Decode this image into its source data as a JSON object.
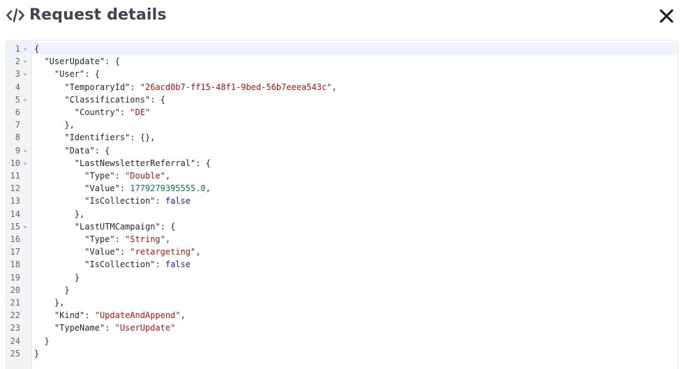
{
  "header": {
    "title": "Request details"
  },
  "icons": {
    "title": "code-icon",
    "close": "close-icon"
  },
  "colors": {
    "string": "#a31515",
    "number": "#0b6e4f",
    "boolean": "#1a1aa6",
    "text": "#1f2328"
  },
  "editor": {
    "active_line": 1,
    "lines": [
      {
        "n": "1",
        "fold": true,
        "indent": 0,
        "tokens": [
          [
            "p",
            "{"
          ]
        ]
      },
      {
        "n": "2",
        "fold": true,
        "indent": 1,
        "tokens": [
          [
            "k",
            "\"UserUpdate\""
          ],
          [
            "p",
            ": {"
          ]
        ]
      },
      {
        "n": "3",
        "fold": true,
        "indent": 2,
        "tokens": [
          [
            "k",
            "\"User\""
          ],
          [
            "p",
            ": {"
          ]
        ]
      },
      {
        "n": "4",
        "fold": false,
        "indent": 3,
        "tokens": [
          [
            "k",
            "\"TemporaryId\""
          ],
          [
            "p",
            ": "
          ],
          [
            "s",
            "\"26acd0b7-ff15-48f1-9bed-56b7eeea543c\""
          ],
          [
            "p",
            ","
          ]
        ]
      },
      {
        "n": "5",
        "fold": true,
        "indent": 3,
        "tokens": [
          [
            "k",
            "\"Classifications\""
          ],
          [
            "p",
            ": {"
          ]
        ]
      },
      {
        "n": "6",
        "fold": false,
        "indent": 4,
        "tokens": [
          [
            "k",
            "\"Country\""
          ],
          [
            "p",
            ": "
          ],
          [
            "s",
            "\"DE\""
          ]
        ]
      },
      {
        "n": "7",
        "fold": false,
        "indent": 3,
        "tokens": [
          [
            "p",
            "},"
          ]
        ]
      },
      {
        "n": "8",
        "fold": false,
        "indent": 3,
        "tokens": [
          [
            "k",
            "\"Identifiers\""
          ],
          [
            "p",
            ": {},"
          ]
        ]
      },
      {
        "n": "9",
        "fold": true,
        "indent": 3,
        "tokens": [
          [
            "k",
            "\"Data\""
          ],
          [
            "p",
            ": {"
          ]
        ]
      },
      {
        "n": "10",
        "fold": true,
        "indent": 4,
        "tokens": [
          [
            "k",
            "\"LastNewsletterReferral\""
          ],
          [
            "p",
            ": {"
          ]
        ]
      },
      {
        "n": "11",
        "fold": false,
        "indent": 5,
        "tokens": [
          [
            "k",
            "\"Type\""
          ],
          [
            "p",
            ": "
          ],
          [
            "s",
            "\"Double\""
          ],
          [
            "p",
            ","
          ]
        ]
      },
      {
        "n": "12",
        "fold": false,
        "indent": 5,
        "tokens": [
          [
            "k",
            "\"Value\""
          ],
          [
            "p",
            ": "
          ],
          [
            "n",
            "1779279395555.0"
          ],
          [
            "p",
            ","
          ]
        ]
      },
      {
        "n": "13",
        "fold": false,
        "indent": 5,
        "tokens": [
          [
            "k",
            "\"IsCollection\""
          ],
          [
            "p",
            ": "
          ],
          [
            "b",
            "false"
          ]
        ]
      },
      {
        "n": "14",
        "fold": false,
        "indent": 4,
        "tokens": [
          [
            "p",
            "},"
          ]
        ]
      },
      {
        "n": "15",
        "fold": true,
        "indent": 4,
        "tokens": [
          [
            "k",
            "\"LastUTMCampaign\""
          ],
          [
            "p",
            ": {"
          ]
        ]
      },
      {
        "n": "16",
        "fold": false,
        "indent": 5,
        "tokens": [
          [
            "k",
            "\"Type\""
          ],
          [
            "p",
            ": "
          ],
          [
            "s",
            "\"String\""
          ],
          [
            "p",
            ","
          ]
        ]
      },
      {
        "n": "17",
        "fold": false,
        "indent": 5,
        "tokens": [
          [
            "k",
            "\"Value\""
          ],
          [
            "p",
            ": "
          ],
          [
            "s",
            "\"retargeting\""
          ],
          [
            "p",
            ","
          ]
        ]
      },
      {
        "n": "18",
        "fold": false,
        "indent": 5,
        "tokens": [
          [
            "k",
            "\"IsCollection\""
          ],
          [
            "p",
            ": "
          ],
          [
            "b",
            "false"
          ]
        ]
      },
      {
        "n": "19",
        "fold": false,
        "indent": 4,
        "tokens": [
          [
            "p",
            "}"
          ]
        ]
      },
      {
        "n": "20",
        "fold": false,
        "indent": 3,
        "tokens": [
          [
            "p",
            "}"
          ]
        ]
      },
      {
        "n": "21",
        "fold": false,
        "indent": 2,
        "tokens": [
          [
            "p",
            "},"
          ]
        ]
      },
      {
        "n": "22",
        "fold": false,
        "indent": 2,
        "tokens": [
          [
            "k",
            "\"Kind\""
          ],
          [
            "p",
            ": "
          ],
          [
            "s",
            "\"UpdateAndAppend\""
          ],
          [
            "p",
            ","
          ]
        ]
      },
      {
        "n": "23",
        "fold": false,
        "indent": 2,
        "tokens": [
          [
            "k",
            "\"TypeName\""
          ],
          [
            "p",
            ": "
          ],
          [
            "s",
            "\"UserUpdate\""
          ]
        ]
      },
      {
        "n": "24",
        "fold": false,
        "indent": 1,
        "tokens": [
          [
            "p",
            "}"
          ]
        ]
      },
      {
        "n": "25",
        "fold": false,
        "indent": 0,
        "tokens": [
          [
            "p",
            "}"
          ]
        ]
      }
    ]
  }
}
